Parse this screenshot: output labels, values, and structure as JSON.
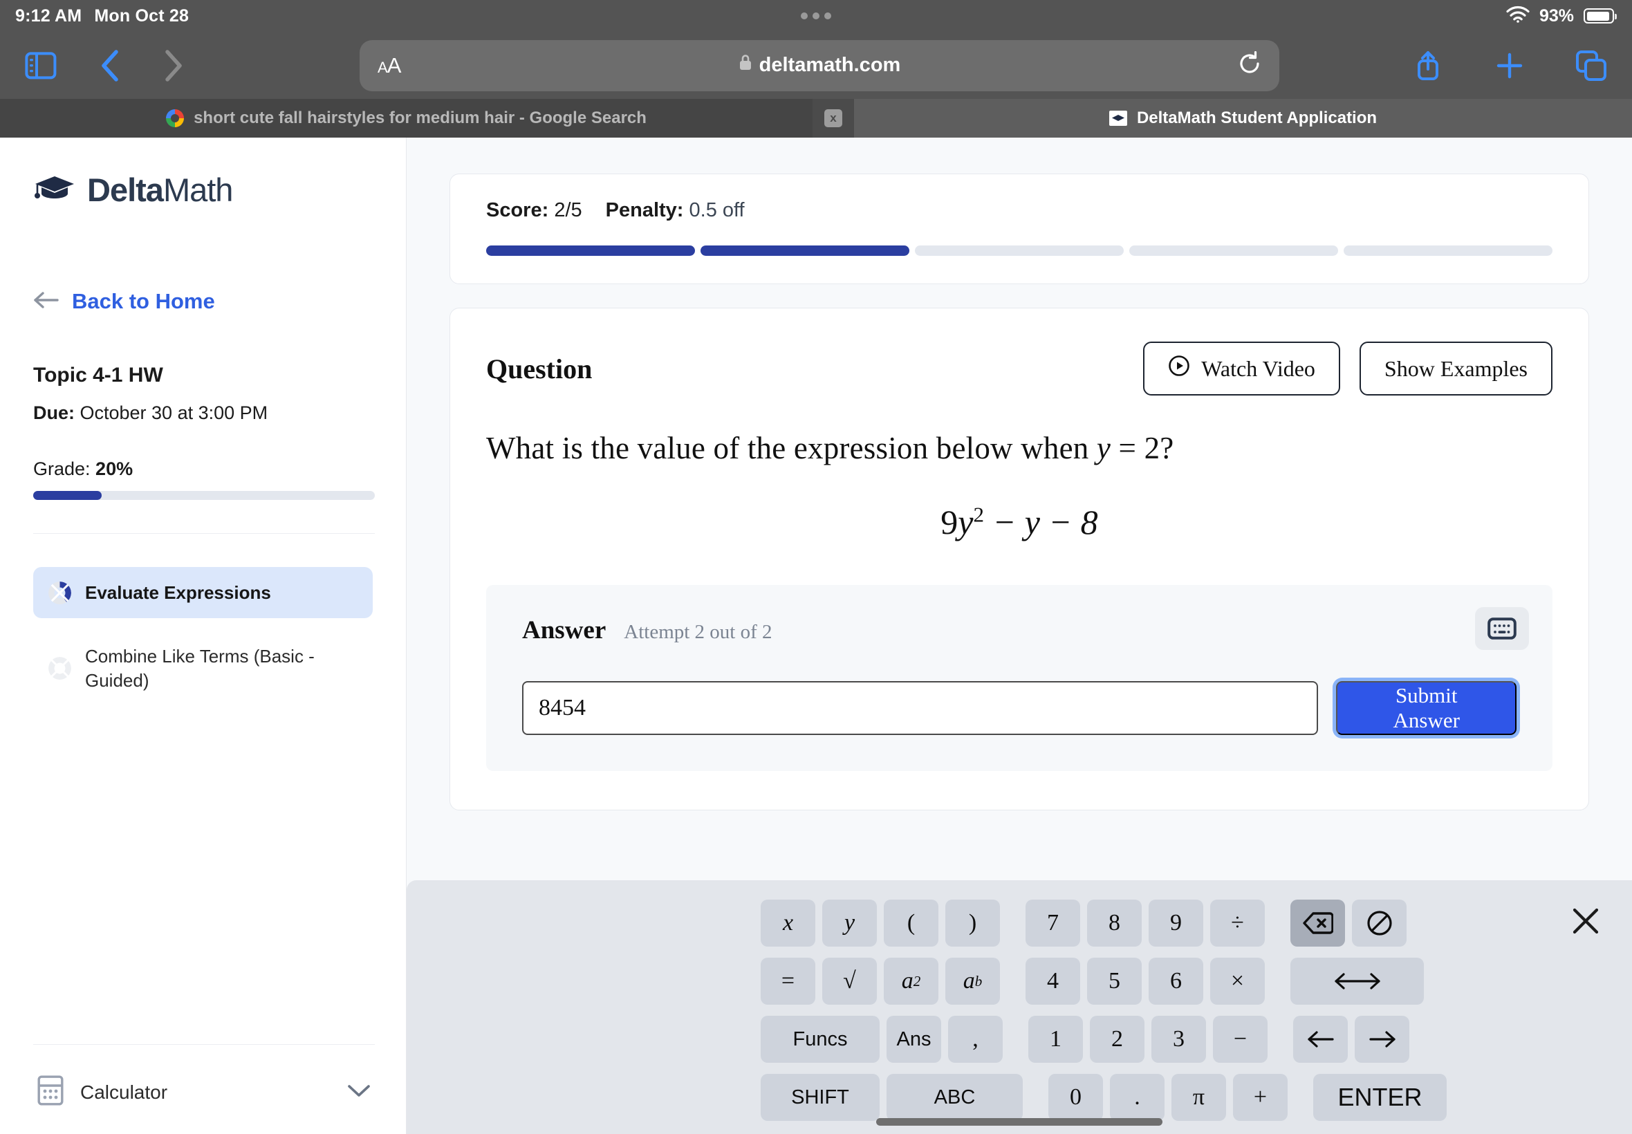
{
  "status_bar": {
    "time": "9:12 AM",
    "date": "Mon Oct 28",
    "battery_percent": "93%",
    "wifi_icon": "wifi-icon",
    "battery_icon": "battery-icon"
  },
  "browser": {
    "sidebar_icon": "sidebar-toggle-icon",
    "back_icon": "chevron-left-icon",
    "forward_icon": "chevron-right-icon",
    "text_size_label": "AA",
    "lock_icon": "lock-icon",
    "url": "deltamath.com",
    "reload_icon": "reload-icon",
    "share_icon": "share-icon",
    "new_tab_icon": "plus-icon",
    "tabs_overview_icon": "tabs-icon",
    "tabs": [
      {
        "title": "short cute fall hairstyles for medium hair - Google Search",
        "favicon": "google-favicon",
        "active": false,
        "close_label": "x"
      },
      {
        "title": "DeltaMath Student Application",
        "favicon": "deltamath-favicon",
        "active": true
      }
    ]
  },
  "sidebar": {
    "brand_bold": "Delta",
    "brand_light": "Math",
    "brand_icon": "graduation-cap-icon",
    "back_arrow_icon": "arrow-left-icon",
    "back_to_home": "Back to Home",
    "assignment_title": "Topic 4-1 HW",
    "due_label": "Due:",
    "due_value": " October 30 at 3:00 PM",
    "grade_label": "Grade: ",
    "grade_value": "20%",
    "grade_percent": 20,
    "topics": [
      {
        "label": "Evaluate Expressions",
        "active": true,
        "progress": 40,
        "icon": "progress-donut-icon"
      },
      {
        "label": "Combine Like Terms (Basic - Guided)",
        "active": false,
        "progress": 0,
        "icon": "progress-donut-icon"
      }
    ],
    "calculator_label": "Calculator",
    "calculator_icon": "calculator-icon",
    "calculator_chevron": "chevron-down-icon"
  },
  "score_card": {
    "score_label": "Score:",
    "score_value": " 2/5",
    "penalty_label": "Penalty:",
    "penalty_value": " 0.5 off",
    "segments": [
      true,
      true,
      false,
      false,
      false
    ]
  },
  "question_card": {
    "heading": "Question",
    "watch_video_label": "Watch Video",
    "watch_video_icon": "play-circle-icon",
    "show_examples_label": "Show Examples",
    "prompt_prefix": "What is the value of the expression below when ",
    "prompt_var": "y",
    "prompt_eq": " = 2?",
    "expression_coefficient": "9",
    "expression_var": "y",
    "expression_exponent": "2",
    "expression_rest": " − y − 8",
    "expression_plain": "9y^2 - y - 8"
  },
  "answer": {
    "title": "Answer",
    "attempt_text": "Attempt 2 out of 2",
    "keyboard_toggle_icon": "keyboard-icon",
    "input_value": "8454",
    "input_placeholder": "",
    "submit_label": "Submit Answer"
  },
  "math_keyboard": {
    "close_icon": "close-icon",
    "rows": [
      {
        "left": [
          {
            "label": "x",
            "name": "key-x",
            "style": "serif-italic"
          },
          {
            "label": "y",
            "name": "key-y",
            "style": "serif-italic"
          },
          {
            "label": "(",
            "name": "key-open-paren",
            "style": "serif"
          },
          {
            "label": ")",
            "name": "key-close-paren",
            "style": "serif"
          }
        ],
        "num": [
          {
            "label": "7",
            "name": "key-7"
          },
          {
            "label": "8",
            "name": "key-8"
          },
          {
            "label": "9",
            "name": "key-9"
          },
          {
            "label": "÷",
            "name": "key-divide"
          }
        ],
        "right": [
          {
            "label": "⌫",
            "name": "key-backspace",
            "dark": true
          },
          {
            "label": "⃠",
            "name": "key-clear"
          }
        ]
      },
      {
        "left": [
          {
            "label": "=",
            "name": "key-equals",
            "style": "serif"
          },
          {
            "label": "√",
            "name": "key-sqrt",
            "style": "serif"
          },
          {
            "label": "a2",
            "name": "key-square",
            "style": "superscript"
          },
          {
            "label": "ab",
            "name": "key-power",
            "style": "superscript"
          }
        ],
        "num": [
          {
            "label": "4",
            "name": "key-4"
          },
          {
            "label": "5",
            "name": "key-5"
          },
          {
            "label": "6",
            "name": "key-6"
          },
          {
            "label": "×",
            "name": "key-multiply"
          }
        ],
        "right": [
          {
            "label": "⟷",
            "name": "key-move-out"
          }
        ]
      },
      {
        "left": [
          {
            "label": "Funcs",
            "name": "key-funcs",
            "style": "sans"
          },
          {
            "label": "Ans",
            "name": "key-ans",
            "style": "sans"
          },
          {
            "label": ",",
            "name": "key-comma",
            "style": "serif"
          }
        ],
        "num": [
          {
            "label": "1",
            "name": "key-1"
          },
          {
            "label": "2",
            "name": "key-2"
          },
          {
            "label": "3",
            "name": "key-3"
          },
          {
            "label": "−",
            "name": "key-minus"
          }
        ],
        "right": [
          {
            "label": "←",
            "name": "key-arrow-left"
          },
          {
            "label": "→",
            "name": "key-arrow-right"
          }
        ]
      },
      {
        "left": [
          {
            "label": "SHIFT",
            "name": "key-shift",
            "style": "sans"
          },
          {
            "label": "ABC",
            "name": "key-abc",
            "style": "sans"
          }
        ],
        "num": [
          {
            "label": "0",
            "name": "key-0"
          },
          {
            "label": ".",
            "name": "key-decimal"
          },
          {
            "label": "π",
            "name": "key-pi"
          },
          {
            "label": "+",
            "name": "key-plus"
          }
        ],
        "right": [
          {
            "label": "ENTER",
            "name": "key-enter",
            "style": "sans"
          }
        ]
      }
    ]
  },
  "colors": {
    "brand_navy": "#2b3ea0",
    "link_blue": "#2f5fe0",
    "submit_blue": "#2f56e8",
    "focus_ring": "#8ab4f8",
    "sidebar_active_bg": "#dbe7fb",
    "track_gray": "#e3e7ee",
    "chrome_gray": "#545454",
    "key_gray": "#ced3dc"
  }
}
